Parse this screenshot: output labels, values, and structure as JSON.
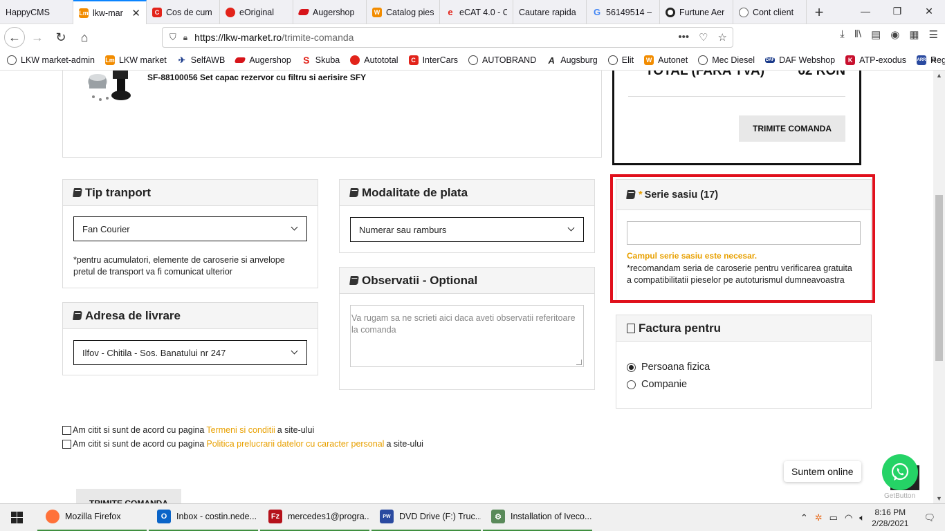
{
  "browser": {
    "tabs": [
      {
        "label": "HappyCMS",
        "color": ""
      },
      {
        "label": "lkw-mar",
        "color": "#f28c00",
        "active": true
      },
      {
        "label": "Cos de cum",
        "color": "#e2231a"
      },
      {
        "label": "eOriginal",
        "color": "#e2231a"
      },
      {
        "label": "Augershop",
        "color": "#d7141a"
      },
      {
        "label": "Catalog pies",
        "color": "#f28c00"
      },
      {
        "label": "eCAT 4.0 - C",
        "color": "#e2231a"
      },
      {
        "label": "Cautare rapida",
        "color": ""
      },
      {
        "label": "56149514 – ",
        "color": "#4285f4"
      },
      {
        "label": "Furtune Aer",
        "color": "#222"
      },
      {
        "label": "Cont client",
        "color": "#666"
      }
    ],
    "url_host": "https://lkw-market.ro",
    "url_path": "/trimite-comanda",
    "bookmarks": [
      {
        "label": "LKW market-admin",
        "icon": "globe"
      },
      {
        "label": "LKW market",
        "icon": "#f28c00"
      },
      {
        "label": "SelfAWB",
        "icon": "#1a3a8a"
      },
      {
        "label": "Augershop",
        "icon": "#d7141a"
      },
      {
        "label": "Skuba",
        "icon": "#e2231a"
      },
      {
        "label": "Autototal",
        "icon": "#e2231a"
      },
      {
        "label": "InterCars",
        "icon": "#e2231a"
      },
      {
        "label": "AUTOBRAND",
        "icon": "globe"
      },
      {
        "label": "Augsburg",
        "icon": "#222"
      },
      {
        "label": "Elit",
        "icon": "globe"
      },
      {
        "label": "Autonet",
        "icon": "#f28c00"
      },
      {
        "label": "Mec Diesel",
        "icon": "globe"
      },
      {
        "label": "DAF Webshop",
        "icon": "#1a3a8a"
      },
      {
        "label": "ATP-exodus",
        "icon": "#c8102e"
      },
      {
        "label": "Registru ARR",
        "icon": "#2a4aa0"
      }
    ]
  },
  "product": {
    "title": "SF-88100056 Set capac rezervor cu filtru si aerisire SFY"
  },
  "summary": {
    "total_label": "TOTAL (FARA TVA)",
    "total_value": "62 RON",
    "submit_label": "TRIMITE COMANDA"
  },
  "transport": {
    "title": "Tip tranport",
    "selected": "Fan Courier",
    "note": "*pentru acumulatori, elemente de caroserie si anvelope pretul de transport va fi comunicat ulterior"
  },
  "address": {
    "title": "Adresa de livrare",
    "selected": "Ilfov - Chitila - Sos. Banatului nr 247"
  },
  "payment": {
    "title": "Modalitate de plata",
    "selected": "Numerar sau ramburs"
  },
  "observations": {
    "title": "Observatii - Optional",
    "placeholder": "Va rugam sa ne scrieti aici daca aveti observatii referitoare la comanda"
  },
  "chassis": {
    "required_mark": "*",
    "title": "Serie sasiu (17)",
    "value": "",
    "error": "Campul serie sasiu este necesar.",
    "note": "*recomandam seria de caroserie pentru verificarea gratuita a compatibilitatii pieselor pe autoturismul dumneavoastra"
  },
  "invoice": {
    "title": "Factura pentru",
    "options": [
      "Persoana fizica",
      "Companie"
    ],
    "selected": "Persoana fizica"
  },
  "agreements": [
    {
      "prefix": "Am citit si sunt de acord cu pagina",
      "link": "Termeni si conditii",
      "suffix": "a site-ului"
    },
    {
      "prefix": "Am citit si sunt de acord cu pagina",
      "link": "Politica prelucrarii datelor cu caracter personal",
      "suffix": "a site-ului"
    }
  ],
  "bottom_submit": "TRIMITE COMANDA",
  "chat": {
    "bubble": "Suntem online",
    "brand": "GetButton"
  },
  "taskbar": {
    "items": [
      {
        "label": "Mozilla Firefox",
        "color": "#ff7139"
      },
      {
        "label": "Inbox - costin.nede...",
        "color": "#0a64c8"
      },
      {
        "label": "mercedes1@progra...",
        "color": "#b5121b"
      },
      {
        "label": "DVD Drive (F:) Truc...",
        "color": "#2a4aa0"
      },
      {
        "label": "Installation of Iveco...",
        "color": "#5a8a5a"
      }
    ],
    "time": "8:16 PM",
    "date": "2/28/2021"
  },
  "colors": {
    "accent": "#e8a000",
    "highlight": "#e0101c",
    "whatsapp": "#25d366"
  }
}
